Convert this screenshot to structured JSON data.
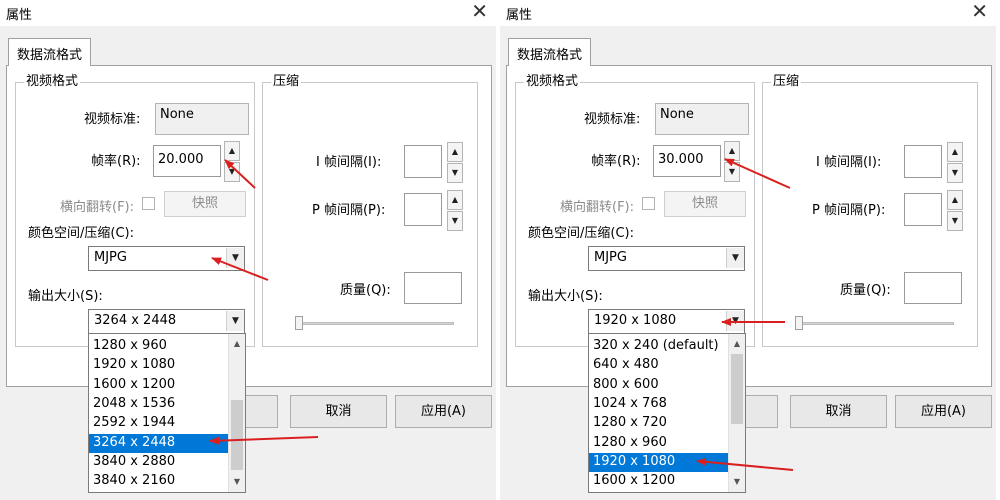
{
  "left": {
    "title": "属性",
    "close_glyph": "✕",
    "tab_label": "数据流格式",
    "video_group": "视频格式",
    "standard_label": "视频标准:",
    "standard_value": "None",
    "fps_label": "帧率(R):",
    "fps_value": "20.000",
    "flip_label": "横向翻转(F):",
    "snapshot_label": "快照",
    "colorspace_label": "颜色空间/压缩(C):",
    "colorspace_value": "MJPG",
    "output_label": "输出大小(S):",
    "output_value": "3264 x 2448",
    "compress_group": "压缩",
    "i_label": "I 帧间隔(I):",
    "p_label": "P 帧间隔(P):",
    "quality_label": "质量(Q):",
    "ok_label": "",
    "cancel_label": "取消",
    "apply_label": "应用(A)",
    "dropdown_items": [
      "1280 x 960",
      "1920 x 1080",
      "1600 x 1200",
      "2048 x 1536",
      "2592 x 1944",
      "3264 x 2448",
      "3840 x 2880",
      "3840 x 2160"
    ],
    "selected_index": 5
  },
  "right": {
    "title": "属性",
    "close_glyph": "✕",
    "tab_label": "数据流格式",
    "video_group": "视频格式",
    "standard_label": "视频标准:",
    "standard_value": "None",
    "fps_label": "帧率(R):",
    "fps_value": "30.000",
    "flip_label": "横向翻转(F):",
    "snapshot_label": "快照",
    "colorspace_label": "颜色空间/压缩(C):",
    "colorspace_value": "MJPG",
    "output_label": "输出大小(S):",
    "output_value": "1920 x 1080",
    "compress_group": "压缩",
    "i_label": "I 帧间隔(I):",
    "p_label": "P 帧间隔(P):",
    "quality_label": "质量(Q):",
    "ok_label": "",
    "cancel_label": "取消",
    "apply_label": "应用(A)",
    "dropdown_items": [
      "320 x 240  (default)",
      "640 x 480",
      "800 x 600",
      "1024 x 768",
      "1280 x 720",
      "1280 x 960",
      "1920 x 1080",
      "1600 x 1200"
    ],
    "selected_index": 6
  },
  "icons": {
    "spin_up": "▲",
    "spin_down": "▼",
    "combo_arrow": "▼",
    "scroll_up": "▲",
    "scroll_down": "▼"
  },
  "annotation_color": "#d9201f",
  "selection_color": "#0078d7"
}
